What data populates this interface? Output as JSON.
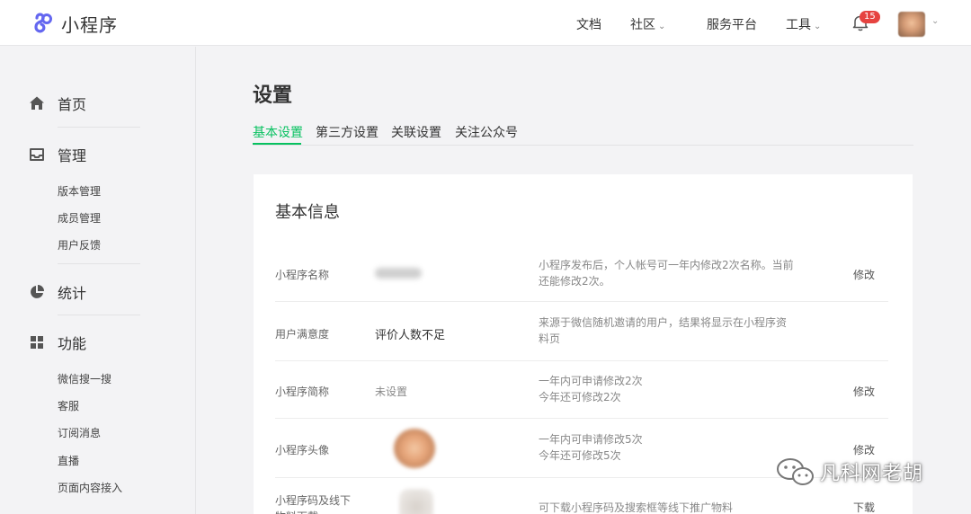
{
  "app": {
    "logo_text": "小程序"
  },
  "topnav": {
    "docs": "文档",
    "community": "社区",
    "service_platform": "服务平台",
    "tools": "工具",
    "notification_count": "15"
  },
  "sidebar": {
    "home": "首页",
    "manage": "管理",
    "manage_items": [
      "版本管理",
      "成员管理",
      "用户反馈"
    ],
    "stats": "统计",
    "features": "功能",
    "feature_items": [
      "微信搜一搜",
      "客服",
      "订阅消息",
      "直播",
      "页面内容接入"
    ]
  },
  "main": {
    "title": "设置",
    "tabs": [
      "基本设置",
      "第三方设置",
      "关联设置",
      "关注公众号"
    ],
    "active_tab": "基本设置",
    "section_title": "基本信息",
    "rows": [
      {
        "label": "小程序名称",
        "value": "",
        "desc": "小程序发布后，个人帐号可一年内修改2次名称。当前还能修改2次。",
        "action": "修改"
      },
      {
        "label": "用户满意度",
        "value": "评价人数不足",
        "desc": "来源于微信随机邀请的用户，结果将显示在小程序资料页",
        "action": ""
      },
      {
        "label": "小程序简称",
        "value": "未设置",
        "desc": "一年内可申请修改2次\n今年还可修改2次",
        "action": "修改"
      },
      {
        "label": "小程序头像",
        "value": "",
        "desc": "一年内可申请修改5次\n今年还可修改5次",
        "action": "修改"
      },
      {
        "label": "小程序码及线下物料下载",
        "value": "",
        "desc": "可下载小程序码及搜索框等线下推广物料",
        "action": "下载"
      }
    ]
  },
  "watermark": {
    "text": "凡科网老胡"
  },
  "colors": {
    "accent": "#07c160",
    "badge": "#e64340"
  }
}
